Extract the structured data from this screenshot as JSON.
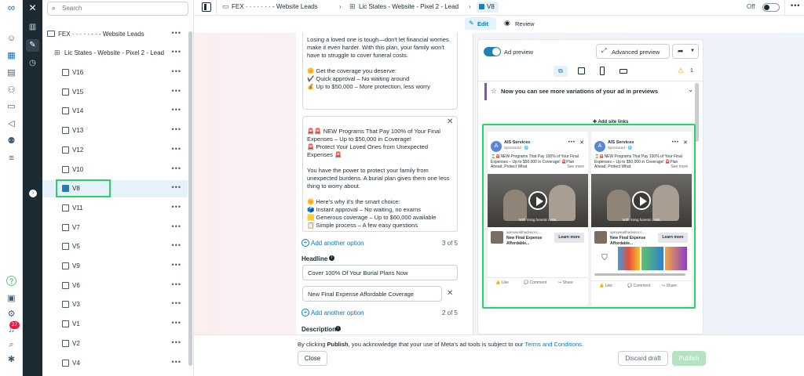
{
  "nav": {
    "notification_count": "27"
  },
  "tree": {
    "search_placeholder": "Search",
    "campaign": "FEX · · · · · · · - Website Leads",
    "adset": "Lic States - Website - Pixel 2 - Lead",
    "ads": [
      "V16",
      "V15",
      "V14",
      "V13",
      "V12",
      "V10",
      "V8",
      "V11",
      "V7",
      "V5",
      "V9",
      "V6",
      "V3",
      "V1",
      "V2",
      "V4"
    ],
    "selected": "V8"
  },
  "breadcrumb": {
    "campaign": "FEX · · · · · · · - Website Leads",
    "adset": "Lic States - Website - Pixel 2 - Lead",
    "ad": "V8",
    "toggle_label": "Off"
  },
  "tabs": {
    "edit": "Edit",
    "review": "Review"
  },
  "editor": {
    "text1": "Losing a loved one is tough—don't let financial worries make it even harder. With this plan, your family won't have to struggle to cover funeral costs.\n\n🌼 Get the coverage you deserve:\n✔️ Quick approval – No waiting around\n💰 Up to $50,000 – More protection, less worry",
    "text2": "🚨🚨 NEW Programs That Pay 100% of Your Final Expenses – Up to $50,000 in Coverage!\n🚨 Protect Your Loved Ones from Unexpected Expenses 🚨\n\nYou have the power to protect your family from unexpected burdens. A burial plan gives them one less thing to worry about.\n\n🌼 Here's why it's the smart choice:\n🗳️ Instant approval – No waiting, no exams\n🟨 Generous coverage – Up to $60,000 available\n📋 Simple process – A few easy questions",
    "add_option": "Add another option",
    "text_counter": "3 of 5",
    "headline_label": "Headline",
    "headline1": "Cover 100% Of Your Burial Plans Now",
    "headline2": "New Final Expense Affordable Coverage",
    "headline_counter": "2 of 5",
    "description_label": "Description"
  },
  "preview": {
    "ad_preview_label": "Ad preview",
    "advanced_button": "Advanced preview",
    "warning_count": "1",
    "banner": "Now you can see more variations of your ad in previews",
    "add_site_links": "Add site links",
    "card": {
      "page_name": "AIS Services",
      "sponsored": "Sponsored · 🌐",
      "avatar_letter": "A",
      "text": "⌛🚨NEW Programs That Pay 100% of Your Final Expenses – Up to $50,000 in Coverage! 🚨Plan Ahead, Protect What",
      "see_more": "See more",
      "video_caption": "With rising funeral costs,",
      "domain": "apexwealthadvisor.c...",
      "headline": "New Final Expense Affordable...",
      "cta": "Learn more",
      "like": "Like",
      "comment": "Comment",
      "share": "Share"
    }
  },
  "footer": {
    "notice_prefix": "By clicking ",
    "notice_bold": "Publish",
    "notice_middle": ", you acknowledge that your use of Meta's ad tools is subject to our ",
    "notice_link": "Terms and Conditions",
    "notice_suffix": ".",
    "close": "Close",
    "discard": "Discard draft",
    "publish": "Publish"
  },
  "colors": {
    "accent": "#0a78be",
    "selection": "#2ad16b",
    "toolbar": "#1c2b33",
    "publish_disabled": "#b5e3c2"
  }
}
